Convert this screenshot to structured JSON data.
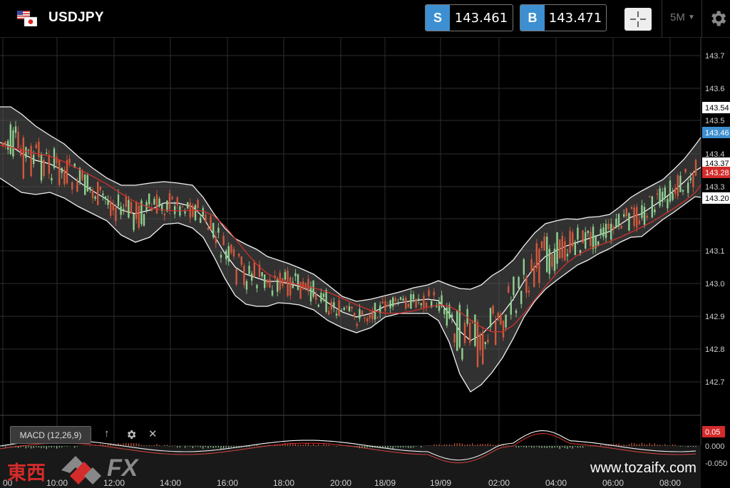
{
  "header": {
    "symbol": "USDJPY",
    "sell": {
      "tag": "S",
      "price": "143.461"
    },
    "buy": {
      "tag": "B",
      "price": "143.471"
    },
    "timeframe": "5M"
  },
  "price_axis": {
    "ticks": [
      "143.7",
      "143.6",
      "143.5",
      "143.4",
      "143.3",
      "143.1",
      "143.0",
      "142.9",
      "142.8",
      "142.7"
    ],
    "badges": [
      {
        "text": "143.54",
        "kind": "white"
      },
      {
        "text": "143.46",
        "kind": "blue"
      },
      {
        "text": "143.37",
        "kind": "white"
      },
      {
        "text": "143.28",
        "kind": "red"
      },
      {
        "text": "143.20",
        "kind": "white"
      }
    ]
  },
  "time_axis": [
    "00",
    "10:00",
    "12:00",
    "14:00",
    "16:00",
    "18:00",
    "20:00",
    "18/09",
    "19/09",
    "02:00",
    "04:00",
    "06:00",
    "08:00"
  ],
  "macd_panel": {
    "label": "MACD (12,26,9)",
    "ticks": [
      "0.000",
      "-0.050"
    ],
    "badge": "0.05"
  },
  "footer": {
    "logo_text": "東西",
    "logo_fx": "FX",
    "website": "www.tozaifx.com"
  },
  "colors": {
    "bull": "#8fcf8f",
    "bear": "#d2583c",
    "ma": "#d0312d",
    "blue": "#3d8fd1",
    "band": "#555555"
  }
}
